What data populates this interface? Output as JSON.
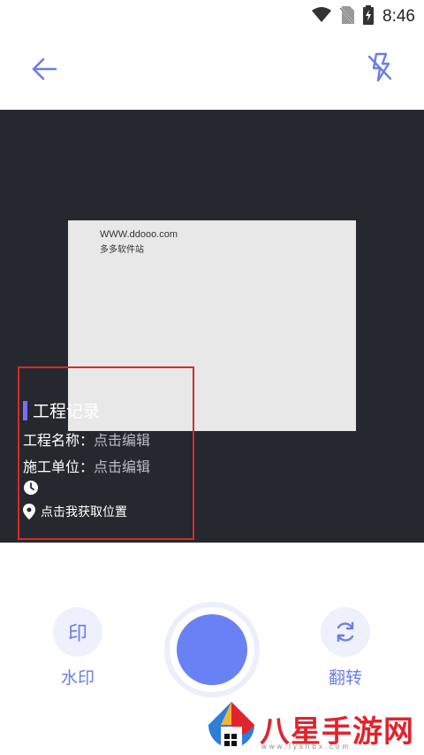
{
  "status_bar": {
    "time": "8:46"
  },
  "camera": {
    "paper_line1": "WWW.ddooo.com",
    "paper_line2": "多多软件站"
  },
  "watermark": {
    "title": "工程记录",
    "project_name_label": "工程名称：",
    "project_name_value": "点击编辑",
    "contractor_label": "施工单位：",
    "contractor_value": "点击编辑",
    "location": "点击我获取位置"
  },
  "bottom": {
    "watermark_icon_char": "印",
    "watermark_label": "水印",
    "flip_label": "翻转"
  },
  "site_logo": {
    "text": "八星手游网",
    "url": "www.lyshbx.com"
  },
  "colors": {
    "accent": "#6a81f6",
    "camera_bg": "#25292f",
    "frame_red": "#d62a2a",
    "title_bar": "#7a6cff"
  }
}
